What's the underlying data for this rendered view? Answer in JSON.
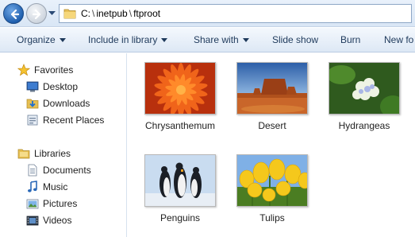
{
  "address": {
    "path_parts": [
      "C:",
      "inetpub",
      "ftproot"
    ],
    "path_text": "C:\\inetpub\\ftproot"
  },
  "toolbar": {
    "items": [
      {
        "label": "Organize",
        "dropdown": true
      },
      {
        "label": "Include in library",
        "dropdown": true
      },
      {
        "label": "Share with",
        "dropdown": true
      },
      {
        "label": "Slide show",
        "dropdown": false
      },
      {
        "label": "Burn",
        "dropdown": false
      },
      {
        "label": "New fo",
        "dropdown": false
      }
    ]
  },
  "nav": {
    "favorites": {
      "label": "Favorites",
      "icon": "star-icon",
      "items": [
        {
          "label": "Desktop",
          "icon": "desktop-icon"
        },
        {
          "label": "Downloads",
          "icon": "downloads-icon"
        },
        {
          "label": "Recent Places",
          "icon": "recent-places-icon"
        }
      ]
    },
    "libraries": {
      "label": "Libraries",
      "icon": "libraries-icon",
      "items": [
        {
          "label": "Documents",
          "icon": "documents-icon"
        },
        {
          "label": "Music",
          "icon": "music-icon"
        },
        {
          "label": "Pictures",
          "icon": "pictures-icon"
        },
        {
          "label": "Videos",
          "icon": "videos-icon"
        }
      ]
    }
  },
  "files": [
    {
      "name": "Chrysanthemum"
    },
    {
      "name": "Desert"
    },
    {
      "name": "Hydrangeas"
    },
    {
      "name": "Penguins"
    },
    {
      "name": "Tulips"
    }
  ],
  "colors": {
    "accent": "#1e395b",
    "nav_selected": "#cce8ff"
  }
}
